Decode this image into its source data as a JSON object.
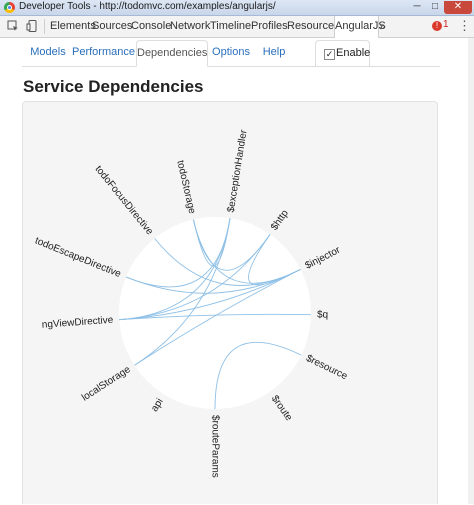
{
  "window": {
    "title": "Developer Tools - http://todomvc.com/examples/angularjs/",
    "controls": [
      "─",
      "□",
      "✕"
    ]
  },
  "devtools": {
    "icons": [
      "inspect-icon",
      "device-icon"
    ],
    "tabs": [
      "Elements",
      "Sources",
      "Console",
      "Network",
      "Timeline",
      "Profiles",
      "Resources",
      "AngularJS"
    ],
    "active_tab": "AngularJS",
    "more": "»",
    "error_count": "1",
    "error_glyph": "!",
    "gear_glyph": "⋮"
  },
  "batarang": {
    "tabs": [
      "Models",
      "Performance",
      "Dependencies",
      "Options",
      "Help"
    ],
    "active_tab": "Dependencies",
    "enable_label": "Enable",
    "enable_checked": true,
    "check_glyph": "✓"
  },
  "page": {
    "heading": "Service Dependencies"
  },
  "graph": {
    "nodes": [
      "$exceptionHandler",
      "$http",
      "$injector",
      "$q",
      "$resource",
      "$route",
      "$routeParams",
      "api",
      "localStorage",
      "ngViewDirective",
      "todoEscapeDirective",
      "todoFocusDirective",
      "todoStorage"
    ],
    "links": [
      {
        "source": "ngViewDirective",
        "target": "$injector"
      },
      {
        "source": "ngViewDirective",
        "target": "$exceptionHandler"
      },
      {
        "source": "ngViewDirective",
        "target": "$http"
      },
      {
        "source": "todoEscapeDirective",
        "target": "$injector"
      },
      {
        "source": "todoEscapeDirective",
        "target": "$exceptionHandler"
      },
      {
        "source": "todoFocusDirective",
        "target": "$injector"
      },
      {
        "source": "todoStorage",
        "target": "$injector"
      },
      {
        "source": "todoStorage",
        "target": "$http"
      },
      {
        "source": "todoStorage",
        "target": "$exceptionHandler"
      },
      {
        "source": "localStorage",
        "target": "$injector"
      },
      {
        "source": "localStorage",
        "target": "$exceptionHandler"
      },
      {
        "source": "$http",
        "target": "$injector"
      },
      {
        "source": "$q",
        "target": "ngViewDirective"
      },
      {
        "source": "$resource",
        "target": "$routeParams"
      }
    ]
  }
}
